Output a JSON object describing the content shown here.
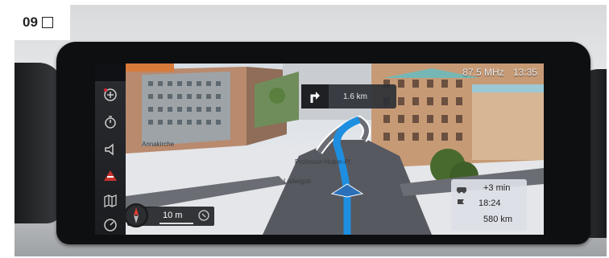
{
  "figure": {
    "label": "09"
  },
  "screen": {
    "status": {
      "radio": "87.5 MHz",
      "clock": "13:35"
    },
    "turn_instruction": {
      "distance": "1.6 km",
      "icon": "turn-right-arrow-icon"
    },
    "sidebar": {
      "items": [
        {
          "name": "traffic-icon"
        },
        {
          "name": "timer-icon"
        },
        {
          "name": "audio-icon"
        },
        {
          "name": "avoid-route-icon"
        },
        {
          "name": "map-view-icon"
        },
        {
          "name": "compass-menu-icon"
        }
      ]
    },
    "map": {
      "streets": [
        "Annakirche",
        "Professor-Huber-Pl.",
        "Ludwigstr."
      ],
      "scale": "10 m",
      "route_color": "#1e8fe0"
    },
    "trip_info": {
      "delay": "+3 min",
      "arrival_time": "18:24",
      "remaining_distance": "580 km"
    }
  }
}
